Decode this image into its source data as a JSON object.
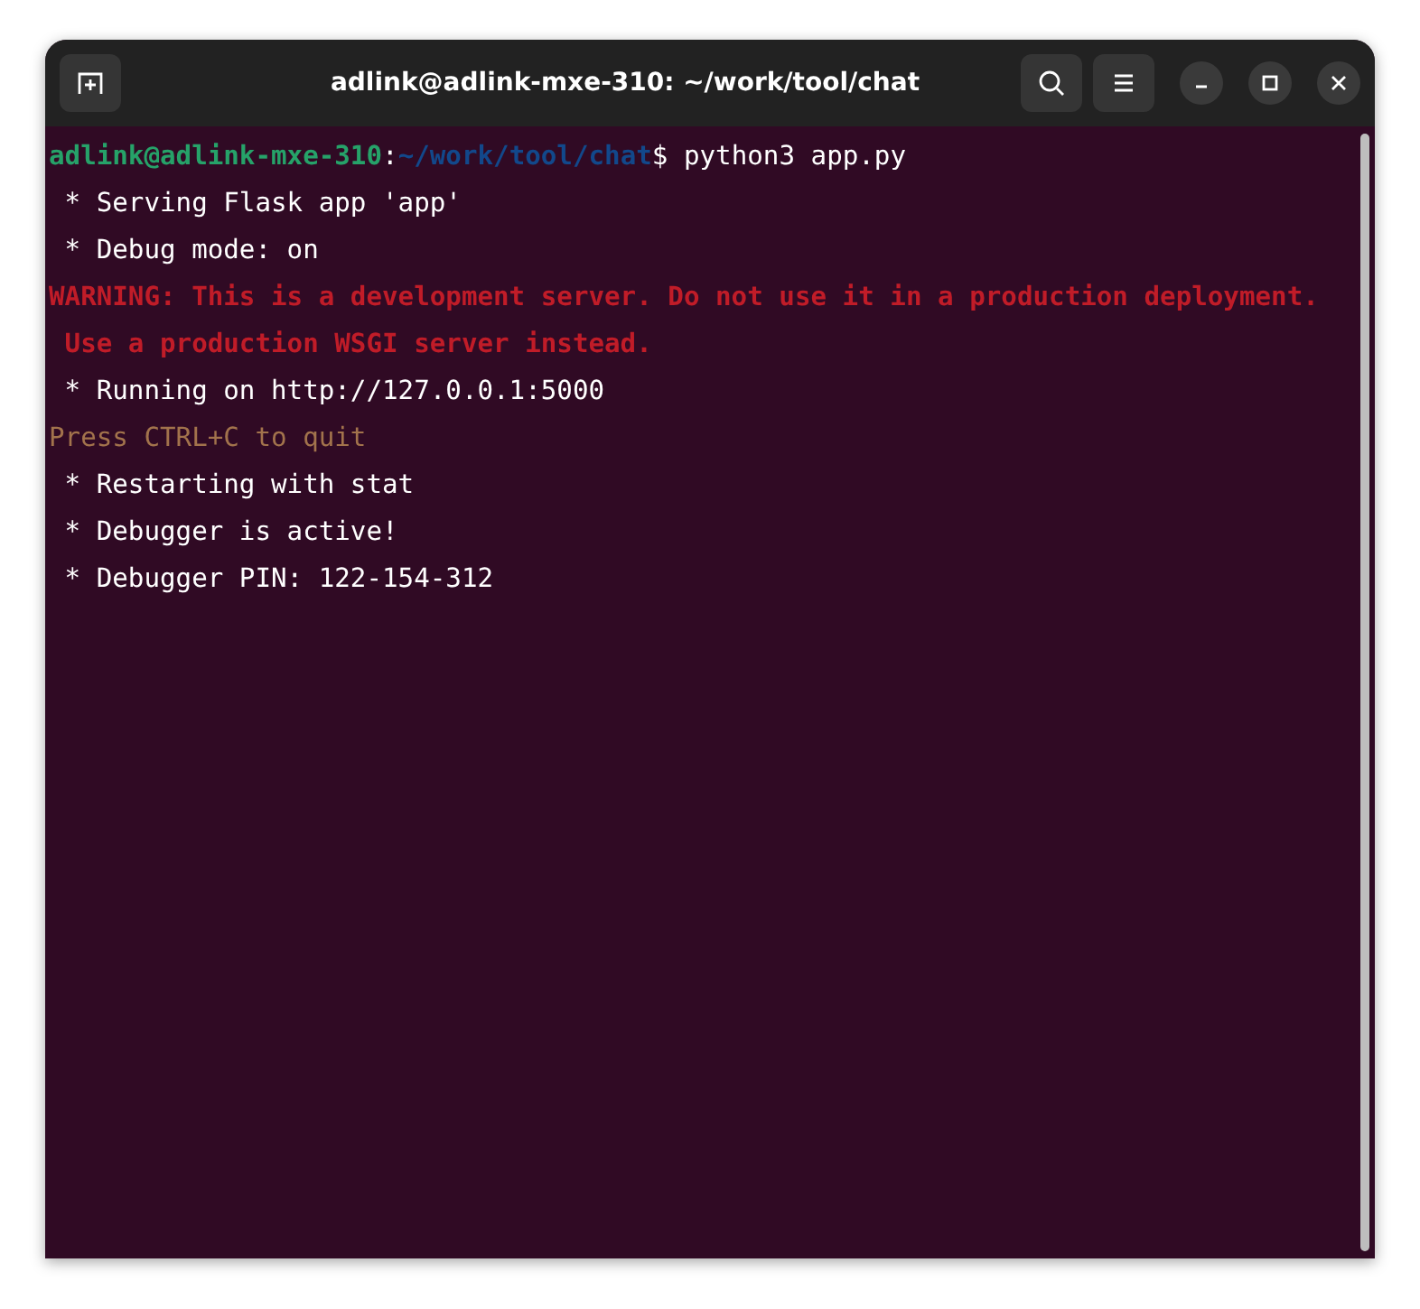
{
  "window": {
    "title": "adlink@adlink-mxe-310: ~/work/tool/chat"
  },
  "terminal": {
    "prompt": {
      "user_host": "adlink@adlink-mxe-310",
      "separator": ":",
      "path": "~/work/tool/chat",
      "dollar": "$",
      "command": " python3 app.py"
    },
    "lines": [
      {
        "kind": "normal",
        "text": " * Serving Flask app 'app'"
      },
      {
        "kind": "normal",
        "text": " * Debug mode: on"
      },
      {
        "kind": "error",
        "text": "WARNING: This is a development server. Do not use it in a production deployment."
      },
      {
        "kind": "error",
        "text": " Use a production WSGI server instead."
      },
      {
        "kind": "normal",
        "text": " * Running on http://127.0.0.1:5000"
      },
      {
        "kind": "notice",
        "text": "Press CTRL+C to quit"
      },
      {
        "kind": "normal",
        "text": " * Restarting with stat"
      },
      {
        "kind": "normal",
        "text": " * Debugger is active!"
      },
      {
        "kind": "normal",
        "text": " * Debugger PIN: 122-154-312"
      }
    ]
  }
}
